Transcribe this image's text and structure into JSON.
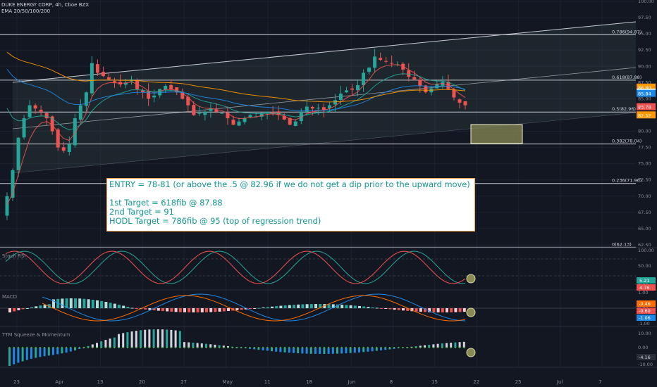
{
  "header": {
    "title": "DUKE ENERGY CORP, 4h, Cboe BZX",
    "indicator": "EMA 20/50/100/200"
  },
  "colors": {
    "background": "#131722",
    "up_candle": "#26a69a",
    "down_candle": "#ef5350",
    "ema_fast": "#ef5350",
    "ema_mid": "#26a69a",
    "ema_slow": "#1e88e5",
    "ema_long": "#ff9800",
    "note_text": "#12968c",
    "note_border": "#f0a24a",
    "box_fill": "#8a8a56"
  },
  "panels": {
    "stoch": "Stoch RSI",
    "macd": "MACD",
    "ttm": "TTM Squeeze & Momentum"
  },
  "note": {
    "line1": "ENTRY = 78-81 (or above the .5 @ 82.96 if we do not get a dip prior to the upward move)",
    "line2": "1st Target = 618fib @ 87.88",
    "line3": "2nd Target = 91",
    "line4": "HODL Target = 786fib @ 95 (top of regression trend)"
  },
  "chart_data": {
    "type": "candlestick",
    "price_axis": {
      "min": 62.5,
      "max": 100,
      "ticks": [
        "100.00",
        "97.50",
        "95.00",
        "92.50",
        "90.00",
        "87.50",
        "85.00",
        "82.50",
        "80.00",
        "77.50",
        "75.00",
        "72.50",
        "70.00",
        "67.50",
        "65.00",
        "62.50"
      ]
    },
    "fib_levels": [
      {
        "label": "0.786(94.87)",
        "value": 94.87
      },
      {
        "label": "0.618(87.88)",
        "value": 87.88
      },
      {
        "label": "0.5(82.96)",
        "value": 82.96
      },
      {
        "label": "0.382(78.04)",
        "value": 78.04
      },
      {
        "label": "0.236(71.96)",
        "value": 71.96
      },
      {
        "label": "0(62.13)",
        "value": 62.13
      }
    ],
    "price_badges": [
      {
        "text": "86.80",
        "value": 86.8,
        "color": "#ff9800"
      },
      {
        "text": "86.02",
        "value": 86.02,
        "color": "#ffffff"
      },
      {
        "text": "85.84",
        "value": 85.84,
        "color": "#1e88e5"
      },
      {
        "text": "83.78",
        "value": 83.78,
        "color": "#ef5350"
      },
      {
        "text": "82.52",
        "value": 82.52,
        "color": "#ff9800"
      }
    ],
    "x_ticks": [
      "23",
      "Apr",
      "13",
      "20",
      "27",
      "May",
      "11",
      "18",
      "Jun",
      "8",
      "15",
      "22",
      "25",
      "Jul",
      "7"
    ],
    "closes": [
      70,
      74,
      79,
      82,
      84,
      83.5,
      83,
      82,
      80,
      77.5,
      77,
      78,
      82,
      84,
      86,
      90.5,
      89,
      88.5,
      88,
      87.5,
      87.2,
      87.5,
      88,
      86.5,
      86,
      85,
      85.5,
      86.5,
      87,
      86.5,
      86,
      85,
      84,
      82.5,
      82.8,
      83,
      83.5,
      83,
      82.8,
      82,
      81,
      81.5,
      82,
      82.5,
      82.3,
      82.8,
      83,
      82.8,
      82.5,
      81.8,
      81,
      81.5,
      83,
      83.8,
      83.5,
      83.6,
      83.3,
      84,
      84.8,
      85.8,
      86.3,
      86.4,
      87.1,
      89,
      89.8,
      91.5,
      91,
      90.8,
      90.5,
      90.3,
      89.5,
      88.4,
      88,
      87,
      86,
      86.6,
      87.3,
      87.6,
      86.5,
      85.2,
      84.4,
      84
    ],
    "stoch_rsi": {
      "axis": [
        "100.00",
        "50.00",
        "0.00"
      ],
      "badges": [
        {
          "text": "5.21",
          "color": "#26a69a"
        },
        {
          "text": "4.76",
          "color": "#ef5350"
        }
      ]
    },
    "macd": {
      "axis": [
        "1.00",
        "0.00",
        "-1.00"
      ],
      "badges": [
        {
          "text": "-0.46",
          "color": "#ff6d00"
        },
        {
          "text": "-0.60",
          "color": "#ef5350"
        },
        {
          "text": "-1.06",
          "color": "#1e88e5"
        }
      ]
    },
    "ttm": {
      "axis": [
        "10.00",
        "0.00",
        "-10.00"
      ],
      "badges": [
        {
          "text": "-4.16",
          "color": "#9598a1"
        }
      ]
    }
  }
}
